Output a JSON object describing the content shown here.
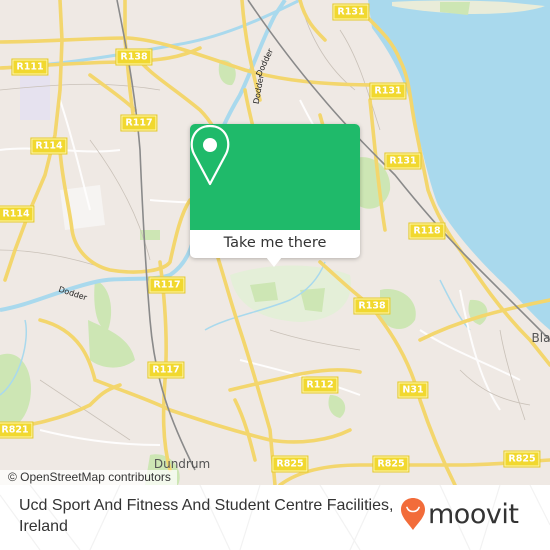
{
  "map": {
    "colors": {
      "land": "#efe9e4",
      "water": "#a9d9ed",
      "park": "#cde6b4",
      "road": "#f7e07a",
      "railway": "#8a8a8a",
      "label_bg": "#f1d82f",
      "accent_green": "#1fba6a",
      "moovit_orange": "#f26c3a"
    },
    "road_labels": [
      {
        "id": "r131-top",
        "text": "R131"
      },
      {
        "id": "r111",
        "text": "R111"
      },
      {
        "id": "r138-nw",
        "text": "R138"
      },
      {
        "id": "r131-mid",
        "text": "R131"
      },
      {
        "id": "r117-n",
        "text": "R117"
      },
      {
        "id": "r114-n",
        "text": "R114"
      },
      {
        "id": "r131-east",
        "text": "R131"
      },
      {
        "id": "r114-w",
        "text": "R114"
      },
      {
        "id": "r118",
        "text": "R118"
      },
      {
        "id": "r117-c",
        "text": "R117"
      },
      {
        "id": "r138-se",
        "text": "R138"
      },
      {
        "id": "r117-s",
        "text": "R117"
      },
      {
        "id": "r112",
        "text": "R112"
      },
      {
        "id": "n31",
        "text": "N31"
      },
      {
        "id": "r821",
        "text": "R821"
      },
      {
        "id": "r825-w",
        "text": "R825"
      },
      {
        "id": "r825-m",
        "text": "R825"
      },
      {
        "id": "r825-e",
        "text": "R825"
      }
    ],
    "place_labels": [
      {
        "id": "dundrum",
        "text": "Dundrum"
      },
      {
        "id": "blackrock",
        "text": "Bla"
      }
    ],
    "river_labels": [
      {
        "id": "dodder-1",
        "text": "Dodder"
      },
      {
        "id": "dodder-2",
        "text": "Dodder"
      },
      {
        "id": "dodder-3",
        "text": "Dodder"
      }
    ],
    "attribution": "© OpenStreetMap contributors"
  },
  "popup": {
    "icon": "map-pin-icon",
    "button_label": "Take me there"
  },
  "footer": {
    "title": "Ucd Sport And Fitness And Student Centre Facilities, Ireland",
    "logo_text": "moovit",
    "logo_icon": "moovit-pin-smile-icon"
  }
}
